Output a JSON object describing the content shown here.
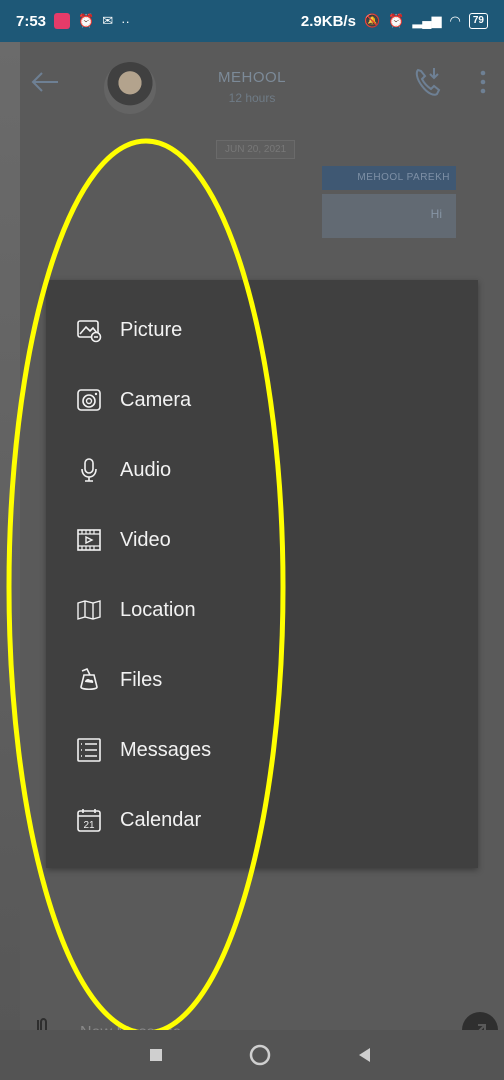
{
  "status_bar": {
    "time": "7:53",
    "network_speed": "2.9KB/s",
    "battery": "79",
    "icons": [
      "notification-icon",
      "alarm-icon",
      "gmail-icon",
      "more-dots-icon",
      "mute-icon",
      "alarm-icon",
      "signal-icon",
      "vowifi-icon",
      "signal-icon",
      "vowifi-icon",
      "wifi-icon",
      "wifi-icon",
      "battery-icon"
    ]
  },
  "header": {
    "contact_name": "MEHOOL",
    "contact_status": "12 hours"
  },
  "chat": {
    "date_chip": "JUN 20, 2021",
    "sender_label": "MEHOOL PAREKH",
    "message_text": "Hi"
  },
  "attach_menu": {
    "items": [
      {
        "label": "Picture",
        "icon": "picture-icon"
      },
      {
        "label": "Camera",
        "icon": "camera-icon"
      },
      {
        "label": "Audio",
        "icon": "microphone-icon"
      },
      {
        "label": "Video",
        "icon": "video-icon"
      },
      {
        "label": "Location",
        "icon": "map-icon"
      },
      {
        "label": "Files",
        "icon": "files-icon"
      },
      {
        "label": "Messages",
        "icon": "messages-icon"
      },
      {
        "label": "Calendar",
        "icon": "calendar-icon"
      }
    ],
    "calendar_day": "21"
  },
  "input_bar": {
    "placeholder": "New Message"
  },
  "colors": {
    "status_bar": "#1e5877",
    "overlay": "#5a5a5a",
    "menu_bg": "#404040",
    "annotation": "#ffff00"
  }
}
